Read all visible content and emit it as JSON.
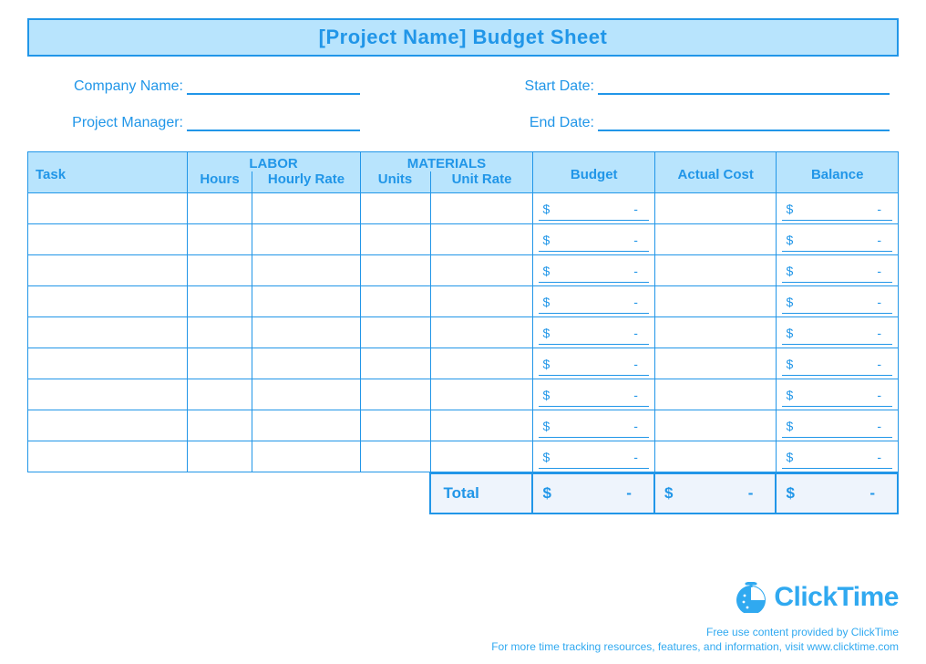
{
  "title": "[Project Name] Budget Sheet",
  "info": {
    "company_label": "Company Name:",
    "start_label": "Start Date:",
    "manager_label": "Project Manager:",
    "end_label": "End Date:"
  },
  "headers": {
    "labor_group": "LABOR",
    "materials_group": "MATERIALS",
    "task": "Task",
    "hours": "Hours",
    "hourly_rate": "Hourly Rate",
    "units": "Units",
    "unit_rate": "Unit Rate",
    "budget": "Budget",
    "actual_cost": "Actual Cost",
    "balance": "Balance"
  },
  "currency_symbol": "$",
  "empty_value": "-",
  "row_count": 9,
  "total_label": "Total",
  "footer": {
    "brand": "ClickTime",
    "line1": "Free use content provided by ClickTime",
    "line2": "For more time tracking resources, features, and information, visit www.clicktime.com"
  }
}
